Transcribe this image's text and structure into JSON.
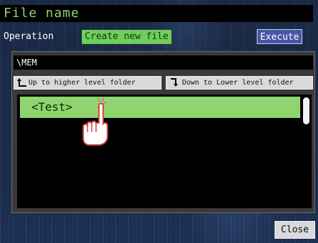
{
  "header": {
    "title": "File name"
  },
  "operation": {
    "label": "Operation",
    "value": "Create new file",
    "execute_label": "Execute"
  },
  "path": {
    "current": "\\MEM"
  },
  "navigation": {
    "up_label": "Up to higher level folder",
    "down_label": "Down to Lower level folder"
  },
  "file_list": {
    "items": [
      {
        "label": "<Test>",
        "selected": true
      }
    ]
  },
  "footer": {
    "close_label": "Close"
  },
  "colors": {
    "accent_green": "#8fd46e",
    "operation_green": "#6fcf5a",
    "execute_blue": "#4656a8",
    "background_navy": "#1b2a45"
  },
  "icons": [
    "up-arrow-icon",
    "down-arrow-icon",
    "pointing-hand-icon"
  ]
}
